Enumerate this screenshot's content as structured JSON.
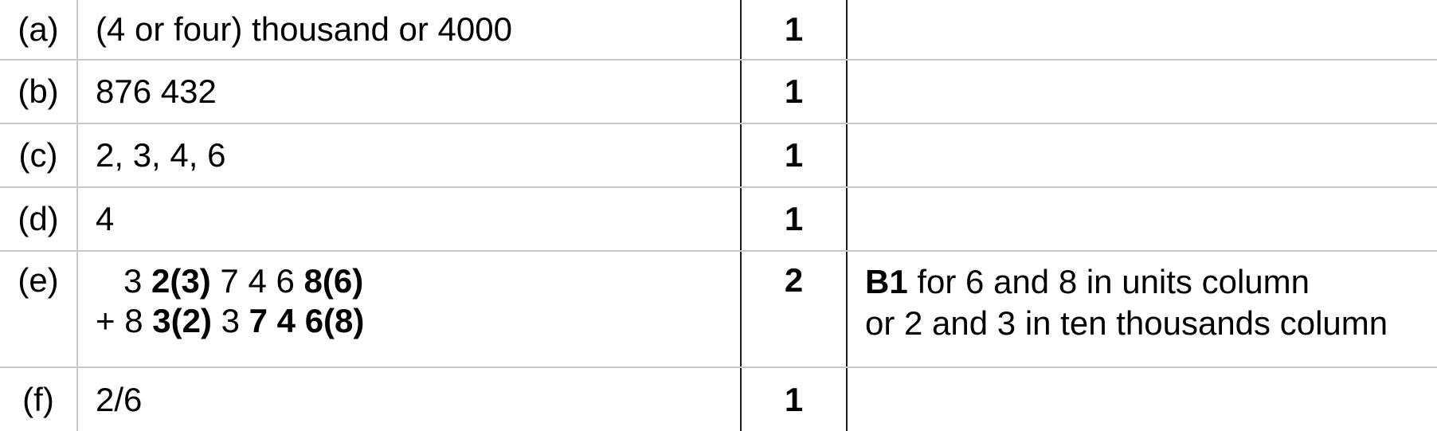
{
  "rows": [
    {
      "part": "(a)",
      "answer": "(4 or four) thousand or 4000",
      "mark": "1",
      "guidance": ""
    },
    {
      "part": "(b)",
      "answer": "876 432",
      "mark": "1",
      "guidance": ""
    },
    {
      "part": "(c)",
      "answer": "2, 3, 4, 6",
      "mark": "1",
      "guidance": ""
    },
    {
      "part": "(d)",
      "answer": "4",
      "mark": "1",
      "guidance": ""
    },
    {
      "part": "(e)",
      "answer_line1": {
        "t1": "   3 ",
        "b1": "2(3)",
        "t2": " 7 4 6 ",
        "b2": "8(6)"
      },
      "answer_line2": {
        "t1": "+ 8 ",
        "b1": "3(2)",
        "t2": " 3 ",
        "b2": "7 4 6(8)"
      },
      "mark": "2",
      "guidance_bold": "B1",
      "guidance_line1": " for 6 and 8 in units column",
      "guidance_line2": "or 2 and 3 in ten thousands column"
    },
    {
      "part": "(f)",
      "answer": "2/6",
      "mark": "1",
      "guidance": ""
    }
  ]
}
